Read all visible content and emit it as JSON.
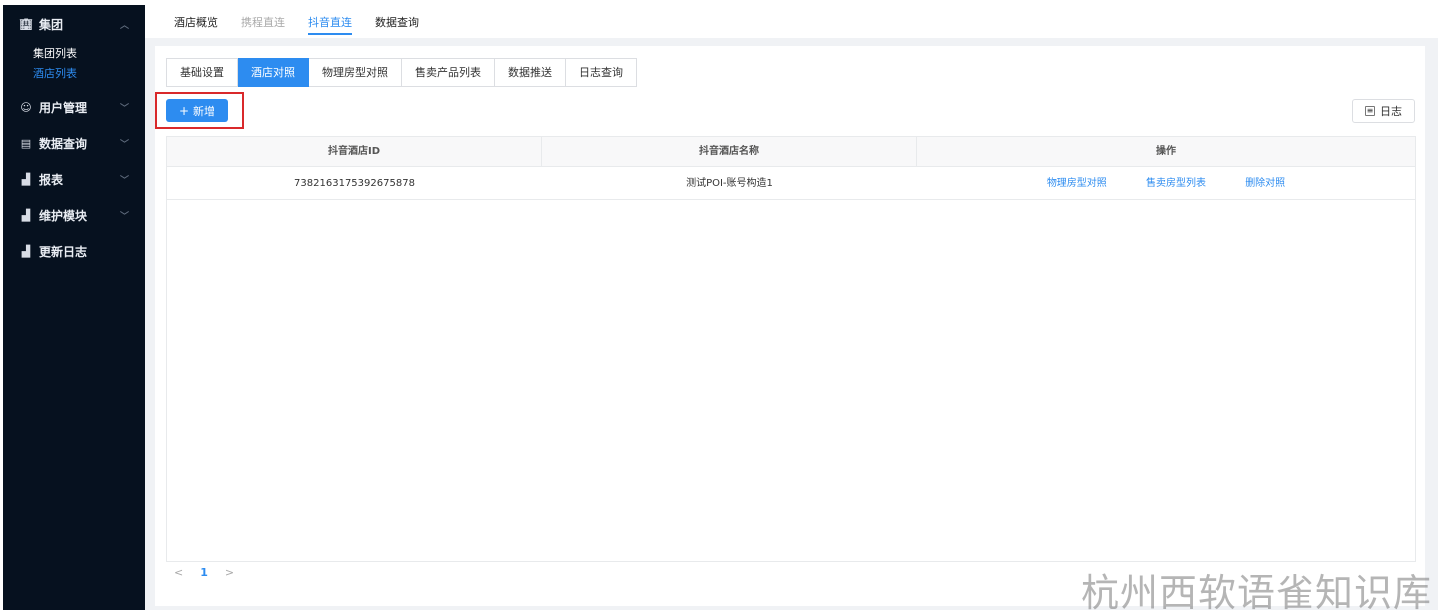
{
  "sidebar": {
    "items": [
      {
        "icon": "building-icon",
        "label": "集团",
        "arrow": "^"
      },
      {
        "icon": "user-icon",
        "label": "用户管理",
        "arrow": "v"
      },
      {
        "icon": "document-search-icon",
        "label": "数据查询",
        "arrow": "v"
      },
      {
        "icon": "bar-chart-icon",
        "label": "报表",
        "arrow": "v"
      },
      {
        "icon": "bar-chart-icon",
        "label": "维护模块",
        "arrow": "v"
      },
      {
        "icon": "bar-chart-icon",
        "label": "更新日志"
      }
    ],
    "sub_items": [
      {
        "label": "集团列表",
        "active": false
      },
      {
        "label": "酒店列表",
        "active": true
      }
    ]
  },
  "topnav": {
    "tabs": [
      {
        "label": "酒店概览",
        "state": "normal"
      },
      {
        "label": "携程直连",
        "state": "muted"
      },
      {
        "label": "抖音直连",
        "state": "active"
      },
      {
        "label": "数据查询",
        "state": "normal"
      }
    ]
  },
  "subtabs": [
    "基础设置",
    "酒店对照",
    "物理房型对照",
    "售卖产品列表",
    "数据推送",
    "日志查询"
  ],
  "active_subtab": "酒店对照",
  "toolbar": {
    "add_label": "新增",
    "log_label": "日志"
  },
  "table": {
    "columns": [
      "抖音酒店ID",
      "抖音酒店名称",
      "操作"
    ],
    "rows": [
      {
        "id": "7382163175392675878",
        "name": "测试POI-账号构造1",
        "actions": [
          "物理房型对照",
          "售卖房型列表",
          "删除对照"
        ]
      }
    ]
  },
  "pagination": {
    "prev": "<",
    "current": "1",
    "next": ">"
  },
  "watermark": "杭州西软语雀知识库",
  "colors": {
    "accent": "#2d8cf0",
    "sidebar_bg": "#06111f",
    "highlight_border": "#d9292b"
  }
}
